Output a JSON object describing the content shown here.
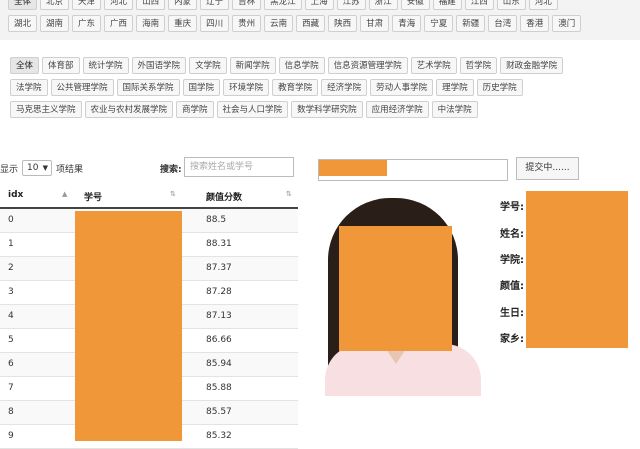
{
  "regions_row1": [
    "全体",
    "北京",
    "天津",
    "河北",
    "山西",
    "内蒙",
    "辽宁",
    "吉林",
    "黑龙江",
    "上海",
    "江苏",
    "浙江",
    "安徽",
    "福建",
    "江西",
    "山东",
    "河北"
  ],
  "regions_row2": [
    "湖北",
    "湖南",
    "广东",
    "广西",
    "海南",
    "重庆",
    "四川",
    "贵州",
    "云南",
    "西藏",
    "陕西",
    "甘肃",
    "青海",
    "宁夏",
    "新疆",
    "台湾",
    "香港",
    "澳门"
  ],
  "colleges_row1": [
    "全体",
    "体育部",
    "统计学院",
    "外国语学院",
    "文学院",
    "新闻学院",
    "信息学院",
    "信息资源管理学院",
    "艺术学院",
    "哲学院",
    "财政金融学院"
  ],
  "colleges_row2": [
    "法学院",
    "公共管理学院",
    "国际关系学院",
    "国学院",
    "环境学院",
    "教育学院",
    "经济学院",
    "劳动人事学院",
    "理学院",
    "历史学院"
  ],
  "colleges_row3": [
    "马克思主义学院",
    "农业与农村发展学院",
    "商学院",
    "社会与人口学院",
    "数学科学研究院",
    "应用经济学院",
    "中法学院"
  ],
  "length": {
    "show": "显示",
    "value": "10",
    "suffix": "项结果"
  },
  "search": {
    "label": "搜索:",
    "placeholder": "搜索姓名或学号"
  },
  "table": {
    "headers": {
      "idx": "idx",
      "id": "学号",
      "score": "颜值分数"
    },
    "rows": [
      {
        "idx": "0",
        "score": "88.5"
      },
      {
        "idx": "1",
        "score": "88.31"
      },
      {
        "idx": "2",
        "score": "87.37"
      },
      {
        "idx": "3",
        "score": "87.28"
      },
      {
        "idx": "4",
        "score": "87.13"
      },
      {
        "idx": "5",
        "score": "86.66"
      },
      {
        "idx": "6",
        "score": "85.94"
      },
      {
        "idx": "7",
        "score": "85.88"
      },
      {
        "idx": "8",
        "score": "85.57"
      },
      {
        "idx": "9",
        "score": "85.32"
      }
    ]
  },
  "submit": {
    "label": "提交中......"
  },
  "profile": {
    "fields": [
      "学号:",
      "姓名:",
      "学院:",
      "颜值:",
      "生日:",
      "家乡:"
    ]
  },
  "colors": {
    "mask": "#f0973a",
    "header_border": "#444444"
  }
}
